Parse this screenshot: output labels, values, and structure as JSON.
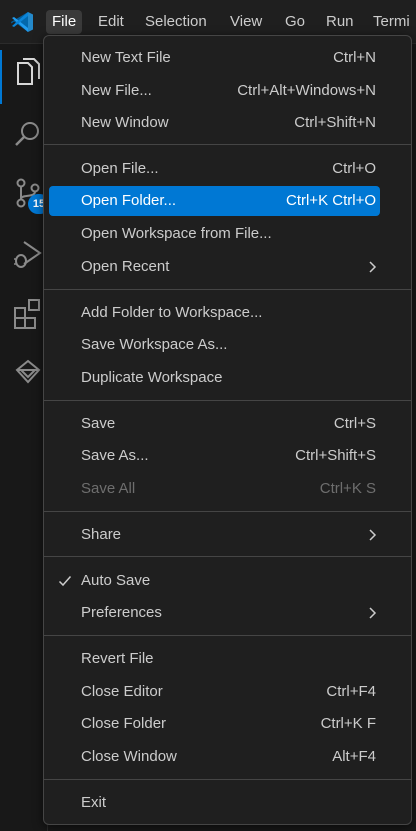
{
  "menubar": {
    "items": [
      {
        "label": "File"
      },
      {
        "label": "Edit"
      },
      {
        "label": "Selection"
      },
      {
        "label": "View"
      },
      {
        "label": "Go"
      },
      {
        "label": "Run"
      },
      {
        "label": "Termi"
      }
    ]
  },
  "activitybar": {
    "scm_badge": "15"
  },
  "file_menu": {
    "items": [
      {
        "label": "New Text File",
        "shortcut": "Ctrl+N"
      },
      {
        "label": "New File...",
        "shortcut": "Ctrl+Alt+Windows+N"
      },
      {
        "label": "New Window",
        "shortcut": "Ctrl+Shift+N"
      },
      {
        "label": "Open File...",
        "shortcut": "Ctrl+O"
      },
      {
        "label": "Open Folder...",
        "shortcut": "Ctrl+K Ctrl+O"
      },
      {
        "label": "Open Workspace from File...",
        "shortcut": ""
      },
      {
        "label": "Open Recent",
        "shortcut": ""
      },
      {
        "label": "Add Folder to Workspace...",
        "shortcut": ""
      },
      {
        "label": "Save Workspace As...",
        "shortcut": ""
      },
      {
        "label": "Duplicate Workspace",
        "shortcut": ""
      },
      {
        "label": "Save",
        "shortcut": "Ctrl+S"
      },
      {
        "label": "Save As...",
        "shortcut": "Ctrl+Shift+S"
      },
      {
        "label": "Save All",
        "shortcut": "Ctrl+K S"
      },
      {
        "label": "Share",
        "shortcut": ""
      },
      {
        "label": "Auto Save",
        "shortcut": ""
      },
      {
        "label": "Preferences",
        "shortcut": ""
      },
      {
        "label": "Revert File",
        "shortcut": ""
      },
      {
        "label": "Close Editor",
        "shortcut": "Ctrl+F4"
      },
      {
        "label": "Close Folder",
        "shortcut": "Ctrl+K F"
      },
      {
        "label": "Close Window",
        "shortcut": "Alt+F4"
      },
      {
        "label": "Exit",
        "shortcut": ""
      }
    ]
  },
  "colors": {
    "accent": "#0078d4",
    "menu_background": "#1f1f1f",
    "text": "#cccccc",
    "disabled_text": "#6e6e6e"
  }
}
